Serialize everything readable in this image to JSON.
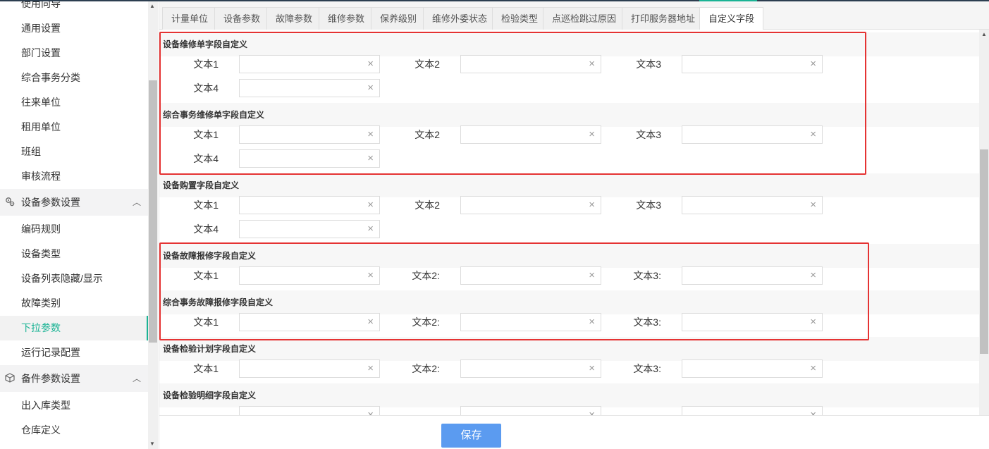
{
  "sidebar": {
    "items_top": [
      "使用向导",
      "通用设置",
      "部门设置",
      "综合事务分类",
      "往来单位",
      "租用单位",
      "班组",
      "审核流程"
    ],
    "group1": {
      "label": "设备参数设置",
      "icon": "gears-icon"
    },
    "group1_items": [
      "编码规则",
      "设备类型",
      "设备列表隐藏/显示",
      "故障类别",
      "下拉参数",
      "运行记录配置"
    ],
    "group2": {
      "label": "备件参数设置",
      "icon": "box-icon"
    },
    "group2_items": [
      "出入库类型",
      "仓库定义"
    ],
    "active_item": "下拉参数"
  },
  "tabs": [
    "计量单位",
    "设备参数",
    "故障参数",
    "维修参数",
    "保养级别",
    "维修外委状态",
    "检验类型",
    "点巡检跳过原因",
    "打印服务器地址",
    "自定义字段"
  ],
  "active_tab": "自定义字段",
  "sections": [
    {
      "title": "设备维修单字段自定义",
      "labels": [
        "文本1",
        "文本2",
        "文本3",
        "文本4"
      ]
    },
    {
      "title": "综合事务维修单字段自定义",
      "labels": [
        "文本1",
        "文本2",
        "文本3",
        "文本4"
      ]
    },
    {
      "title": "设备购置字段自定义",
      "labels": [
        "文本1",
        "文本2",
        "文本3",
        "文本4"
      ]
    },
    {
      "title": "设备故障报修字段自定义",
      "labels": [
        "文本1",
        "文本2:",
        "文本3:"
      ]
    },
    {
      "title": "综合事务故障报修字段自定义",
      "labels": [
        "文本1",
        "文本2:",
        "文本3:"
      ]
    },
    {
      "title": "设备检验计划字段自定义",
      "labels": [
        "文本1",
        "文本2:",
        "文本3:"
      ]
    },
    {
      "title": "设备检验明细字段自定义",
      "labels": []
    }
  ],
  "field_values": {
    "s0": [
      "",
      "",
      "",
      ""
    ],
    "s1": [
      "",
      "",
      "",
      ""
    ],
    "s2": [
      "",
      "",
      "",
      ""
    ],
    "s3": [
      "",
      "",
      ""
    ],
    "s4": [
      "",
      "",
      ""
    ],
    "s5": [
      "",
      "",
      ""
    ]
  },
  "clear_icon": "×",
  "footer": {
    "save_label": "保存"
  },
  "colors": {
    "accent": "#1ab394",
    "save_button": "#5b9bf0",
    "highlight_box": "#e53333"
  }
}
